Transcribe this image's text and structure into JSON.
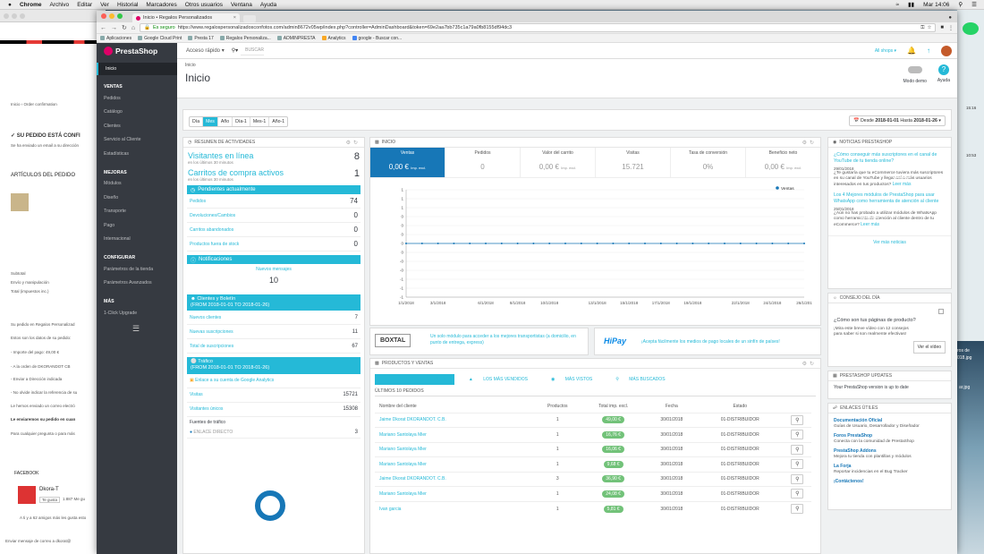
{
  "mac_menu": {
    "apple": "",
    "app": "Chrome",
    "items": [
      "Archivo",
      "Editar",
      "Ver",
      "Historial",
      "Marcadores",
      "Otros usuarios",
      "Ventana",
      "Ayuda"
    ],
    "clock": "Mar 14:06"
  },
  "bg_window": {
    "breadcrumb": "Inicio  ›  Order confirmation",
    "confirm": "✓ SU PEDIDO ESTÁ CONFI",
    "email_note": "Se ha enviado un email a su dirección",
    "items_title": "ARTÍCULOS DEL PEDIDO",
    "subtotal": "Subtotal",
    "shipping": "Envío y manipulación",
    "total": "Total (impuestos inc.)",
    "info1": "Su pedido en Regalos Personalizad",
    "info2": "Estos son los datos de su pedido:",
    "info3": "- Importe del pago: 49,00 €",
    "info4": "- A la orden de DKORANDOT CB",
    "info5": "- Enviar a Dirección indicada",
    "info6": "- No olvide indicar la referencia de su",
    "info7": "Le hemos enviado un correo electró",
    "info8": "Le enviaremos su pedido en cuan",
    "info9": "Para cualquier pregunta o para más",
    "facebook": "FACEBOOK",
    "fb_page": "Dkora-T",
    "fb_like": "Te gusta",
    "fb_likes": "1.887 Me gu",
    "fb_friends": "A ti y a 62 amigos más les gusta esto",
    "newsletter": "Enviar mensaje de correo a dkorat@"
  },
  "browser": {
    "tab_title": "Inicio • Regalos Personalizados",
    "secure": "Es seguro",
    "url": "https://www.regalospersonalizadosconfotos.com/admin8672v05wp/index.php?controller=AdminDashboard&token=69e2aa7bb735c1a79a0fb8155df94dc3",
    "bookmarks": [
      "Aplicaciones",
      "Google Cloud Print",
      "Presta 17",
      "Regalos Personaliza...",
      "ADMINPRESTA",
      "Analytics",
      "google - Buscar con..."
    ]
  },
  "topnav": {
    "logo": "PrestaShop",
    "quick_access": "Acceso rápido ▾",
    "search_placeholder": "Buscar",
    "all_shops": "All shops ▾"
  },
  "sidebar": {
    "active": "Inicio",
    "sections": [
      {
        "title": "VENTAS",
        "items": [
          "Pedidos",
          "Catálogo",
          "Clientes",
          "Servicio al Cliente",
          "Estadísticas"
        ]
      },
      {
        "title": "MEJORAS",
        "items": [
          "Módulos",
          "Diseño",
          "Transporte",
          "Pago",
          "Internacional"
        ]
      },
      {
        "title": "CONFIGURAR",
        "items": [
          "Parámetros de la tienda",
          "Parámetros Avanzados"
        ]
      },
      {
        "title": "MÁS",
        "items": [
          "1-Click Upgrade"
        ]
      }
    ]
  },
  "page": {
    "breadcrumb": "Inicio",
    "title": "Inicio",
    "demo_mode": "Modo demo",
    "help": "Ayuda"
  },
  "datebar": {
    "periods": [
      "Día",
      "Mes",
      "Año",
      "Día-1",
      "Mes-1",
      "Año-1"
    ],
    "active_period": "Mes",
    "range_prefix": "Desde",
    "from": "2018-01-01",
    "to_label": "Hasta",
    "to": "2018-01-26"
  },
  "activity": {
    "title": "RESUMEN DE ACTIVIDADES",
    "visitors_label": "Visitantes en línea",
    "visitors_sub": "en los últimos 30 minutos",
    "visitors": "8",
    "carts_label": "Carritos de compra activos",
    "carts_sub": "en los últimos 30 minutos",
    "carts": "1",
    "pending_title": "Pendientes actualmente",
    "pending": [
      {
        "k": "Pedidos",
        "v": "74"
      },
      {
        "k": "Devoluciones/Cambios",
        "v": "0"
      },
      {
        "k": "Carritos abandonados",
        "v": "0"
      },
      {
        "k": "Productos fuera de stock",
        "v": "0"
      }
    ],
    "notif_title": "Notificaciones",
    "notif_label": "Nuevos mensajes",
    "notif_value": "10",
    "customers_title": "Clientes y Boletín",
    "customers_range": "(FROM 2018-01-01 TO 2018-01-26)",
    "customers": [
      {
        "k": "Nuevos clientes",
        "v": "7"
      },
      {
        "k": "Nuevas suscripciones",
        "v": "11"
      },
      {
        "k": "Total de suscripciones",
        "v": "67"
      }
    ],
    "traffic_title": "Tráfico",
    "traffic_range": "(FROM 2018-01-01 TO 2018-01-26)",
    "ga_link": "Enlace a su cuenta de Google Analytics",
    "traffic": [
      {
        "k": "Visitas",
        "v": "15721"
      },
      {
        "k": "Visitantes únicos",
        "v": "15308"
      }
    ],
    "sources_label": "Fuentes de tráfico",
    "direct_label": "ENLACE DIRECTO",
    "direct_value": "3"
  },
  "inicio": {
    "title": "INICIO",
    "kpis": [
      {
        "label": "Ventas",
        "value": "0,00 €",
        "sub": "Imp. excl."
      },
      {
        "label": "Pedidos",
        "value": "0",
        "sub": ""
      },
      {
        "label": "Valor del carrito",
        "value": "0,00 €",
        "sub": "Imp. excl."
      },
      {
        "label": "Visitas",
        "value": "15.721",
        "sub": ""
      },
      {
        "label": "Tasa de conversión",
        "value": "0%",
        "sub": ""
      },
      {
        "label": "Beneficio neto",
        "value": "0,00 €",
        "sub": "Imp. excl."
      }
    ]
  },
  "chart_data": {
    "type": "line",
    "x": [
      "1/1/2018",
      "2/1/2018",
      "3/1/2018",
      "4/1/2018",
      "5/1/2018",
      "6/1/2018",
      "7/1/2018",
      "8/1/2018",
      "9/1/2018",
      "10/1/2018",
      "11/1/2018",
      "12/1/2018",
      "13/1/2018",
      "14/1/2018",
      "15/1/2018",
      "16/1/2018",
      "17/1/2018",
      "18/1/2018",
      "19/1/2018",
      "20/1/2018",
      "21/1/2018",
      "22/1/2018",
      "23/1/2018",
      "24/1/2018",
      "25/1/2018",
      "26/1/2018"
    ],
    "x_tick_labels": [
      "1/1/2018",
      "3/1/2018",
      "6/1/2018",
      "8/1/2018",
      "10/1/2018",
      "13/1/2018",
      "15/1/2018",
      "17/1/2018",
      "19/1/2018",
      "22/1/2018",
      "24/1/2018",
      "26/1/201"
    ],
    "series": [
      {
        "name": "Ventas",
        "values": [
          0,
          0,
          0,
          0,
          0,
          0,
          0,
          0,
          0,
          0,
          0,
          0,
          0,
          0,
          0,
          0,
          0,
          0,
          0,
          0,
          0,
          0,
          0,
          0,
          0,
          0
        ]
      }
    ],
    "y_ticks": [
      "1",
      "1",
      "1",
      "0",
      "0",
      "0",
      "0",
      "0",
      "-0",
      "-0",
      "-1",
      "-1",
      "-1"
    ],
    "ylim": [
      -1,
      1
    ],
    "legend": "top-right",
    "color": "#1777b7"
  },
  "boxtal": {
    "logo": "BOXTAL",
    "text": "Un solo módulo para acceder a los mejores transportistas (a domicilio, en punto de entrega, express)"
  },
  "hipay": {
    "logo": "HiPay",
    "text": "¡Acepta fácilmente los medios de pago locales de un sinfín de países!"
  },
  "products": {
    "title": "PRODUCTOS Y VENTAS",
    "tabs": [
      "PEDIDOS RECIENTES",
      "LOS MÁS VENDIDOS",
      "MÁS VISTOS",
      "MÁS BUSCADOS"
    ],
    "table_title": "Últimos 10 pedidos",
    "columns": [
      "Nombre del cliente",
      "Productos",
      "Total imp. excl.",
      "Fecha",
      "Estado"
    ],
    "rows": [
      [
        "Jaime Dkorat DKORANDOT. C.B.",
        "1",
        "49,00 €",
        "30/01/2018",
        "01-DISTRIBUIDOR"
      ],
      [
        "Mariano Santolaya Mier",
        "1",
        "16,76 €",
        "30/01/2018",
        "01-DISTRIBUIDOR"
      ],
      [
        "Mariano Santolaya Mier",
        "1",
        "16,06 €",
        "30/01/2018",
        "01-DISTRIBUIDOR"
      ],
      [
        "Mariano Santolaya Mier",
        "1",
        "9,68 €",
        "30/01/2018",
        "01-DISTRIBUIDOR"
      ],
      [
        "Jaime Dkorat DKORANDOT. C.B.",
        "3",
        "36,90 €",
        "30/01/2018",
        "01-DISTRIBUIDOR"
      ],
      [
        "Mariano Santolaya Mier",
        "1",
        "24,08 €",
        "30/01/2018",
        "01-DISTRIBUIDOR"
      ],
      [
        "Ivan garcia",
        "1",
        "5,81 €",
        "30/01/2018",
        "01-DISTRIBUIDOR"
      ]
    ]
  },
  "news": {
    "title": "NOTICIAS PRESTASHOP",
    "items": [
      {
        "title": "¿Cómo conseguir más suscriptores en el canal de YouTube de tu tienda online?",
        "date": "29/01/2018",
        "body": "¿Te gustaría que tu eCommerce tuviera más suscriptores en su canal de YouTube y llegar así a más usuarios interesados en tus productos?",
        "more": "Leer más"
      },
      {
        "title": "Los 4 Mejores módulos de PrestaShop para usar WhatsApp como herramienta de atención al cliente",
        "date": "25/01/2018",
        "body": "¿Aún no has probado a utilizar módulos de WhatsApp como herramienta de atención al cliente dentro de tu eCommerce?",
        "more": "Leer más"
      }
    ],
    "see_more": "Ver más noticias"
  },
  "advice": {
    "title": "CONSEJO DEL DÍA",
    "headline": "¿Cómo son tus páginas de producto?",
    "body": "¡Mira este breve vídeo con 12 consejos para saber si son realmente efectivas!",
    "button": "Ver el vídeo"
  },
  "updates": {
    "title": "PRESTASHOP UPDATES",
    "text": "Your PrestaShop version is up to date"
  },
  "links": {
    "title": "ENLACES ÚTILES",
    "items": [
      {
        "t": "Documentación Oficial",
        "d": "Guías de Usuario, Desarrollador y Diseñador"
      },
      {
        "t": "Foros PrestaShop",
        "d": "Conecta con la comunidad de PrestaShop"
      },
      {
        "t": "PrestaShop Addons",
        "d": "Mejora tu tienda con plantillas y módulos"
      },
      {
        "t": "La Forja",
        "d": "Reportar incidencias en el Bug Tracker"
      },
      {
        "t": "¡Contáctenos!",
        "d": ""
      }
    ]
  },
  "right_strip": {
    "labels": [
      "15:16",
      "10:53",
      "ros de",
      "018.jpg",
      "ar.jpg"
    ]
  }
}
